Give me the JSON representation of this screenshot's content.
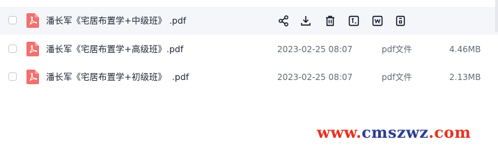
{
  "files": [
    {
      "name": "潘长军《宅居布置学+中级班》 .pdf",
      "date": "",
      "type": "",
      "size": ""
    },
    {
      "name": "潘长军《宅居布置学+高级班》.pdf",
      "date": "2023-02-25 08:07",
      "type": "pdf文件",
      "size": "4.46MB"
    },
    {
      "name": "潘长军《宅居布置学+初级班》  .pdf",
      "date": "2023-02-25 08:07",
      "type": "pdf文件",
      "size": "2.13MB"
    }
  ],
  "row_actions": [
    "share-icon",
    "download-icon",
    "delete-icon",
    "rename-icon",
    "word-convert-icon",
    "document-icon"
  ],
  "watermark": {
    "part1": "www.",
    "part2": "cmszwz",
    "part3": ".com"
  },
  "colors": {
    "pdf_red": "#f2706e",
    "hover_row": "#f5f6fa",
    "icon_dark": "#03081a",
    "watermark_red": "#e5321e",
    "watermark_blue": "#2c3c93"
  }
}
